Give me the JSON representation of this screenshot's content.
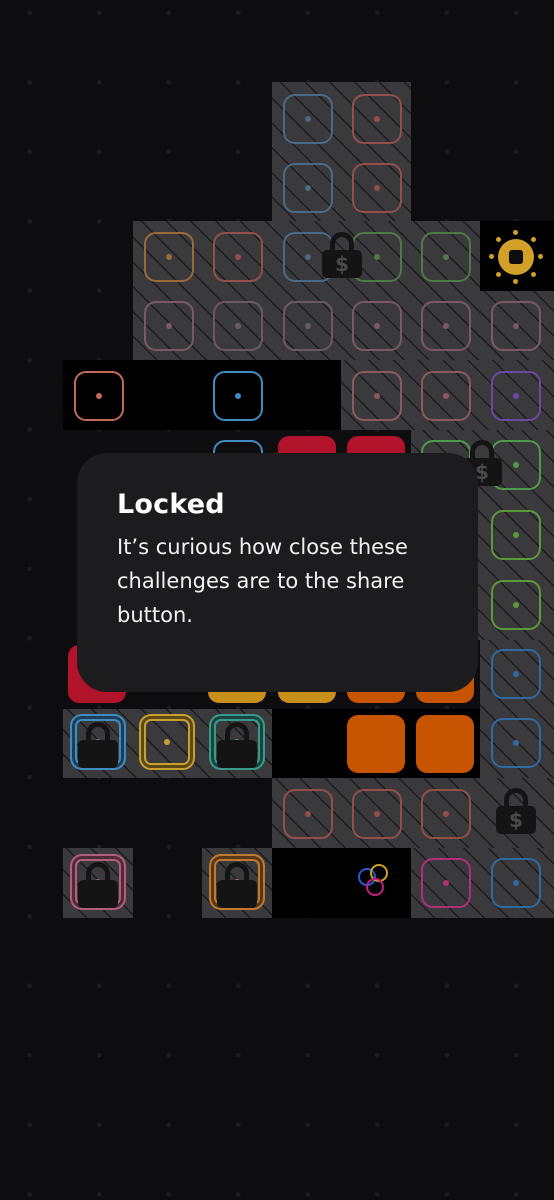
{
  "dialog": {
    "title": "Locked",
    "message": "It’s curious how close these challenges are to the share button."
  },
  "colors": {
    "background": "#0d0d0f",
    "locked_area": "#3a3a3c",
    "dialog_background": "#1c1c1e",
    "sun_gold": "#d2a028",
    "lock_icon": "#141414"
  },
  "icons": [
    "padlock-dollar-icon",
    "padlock-icon",
    "sun-icon",
    "share-circles-icon"
  ]
}
